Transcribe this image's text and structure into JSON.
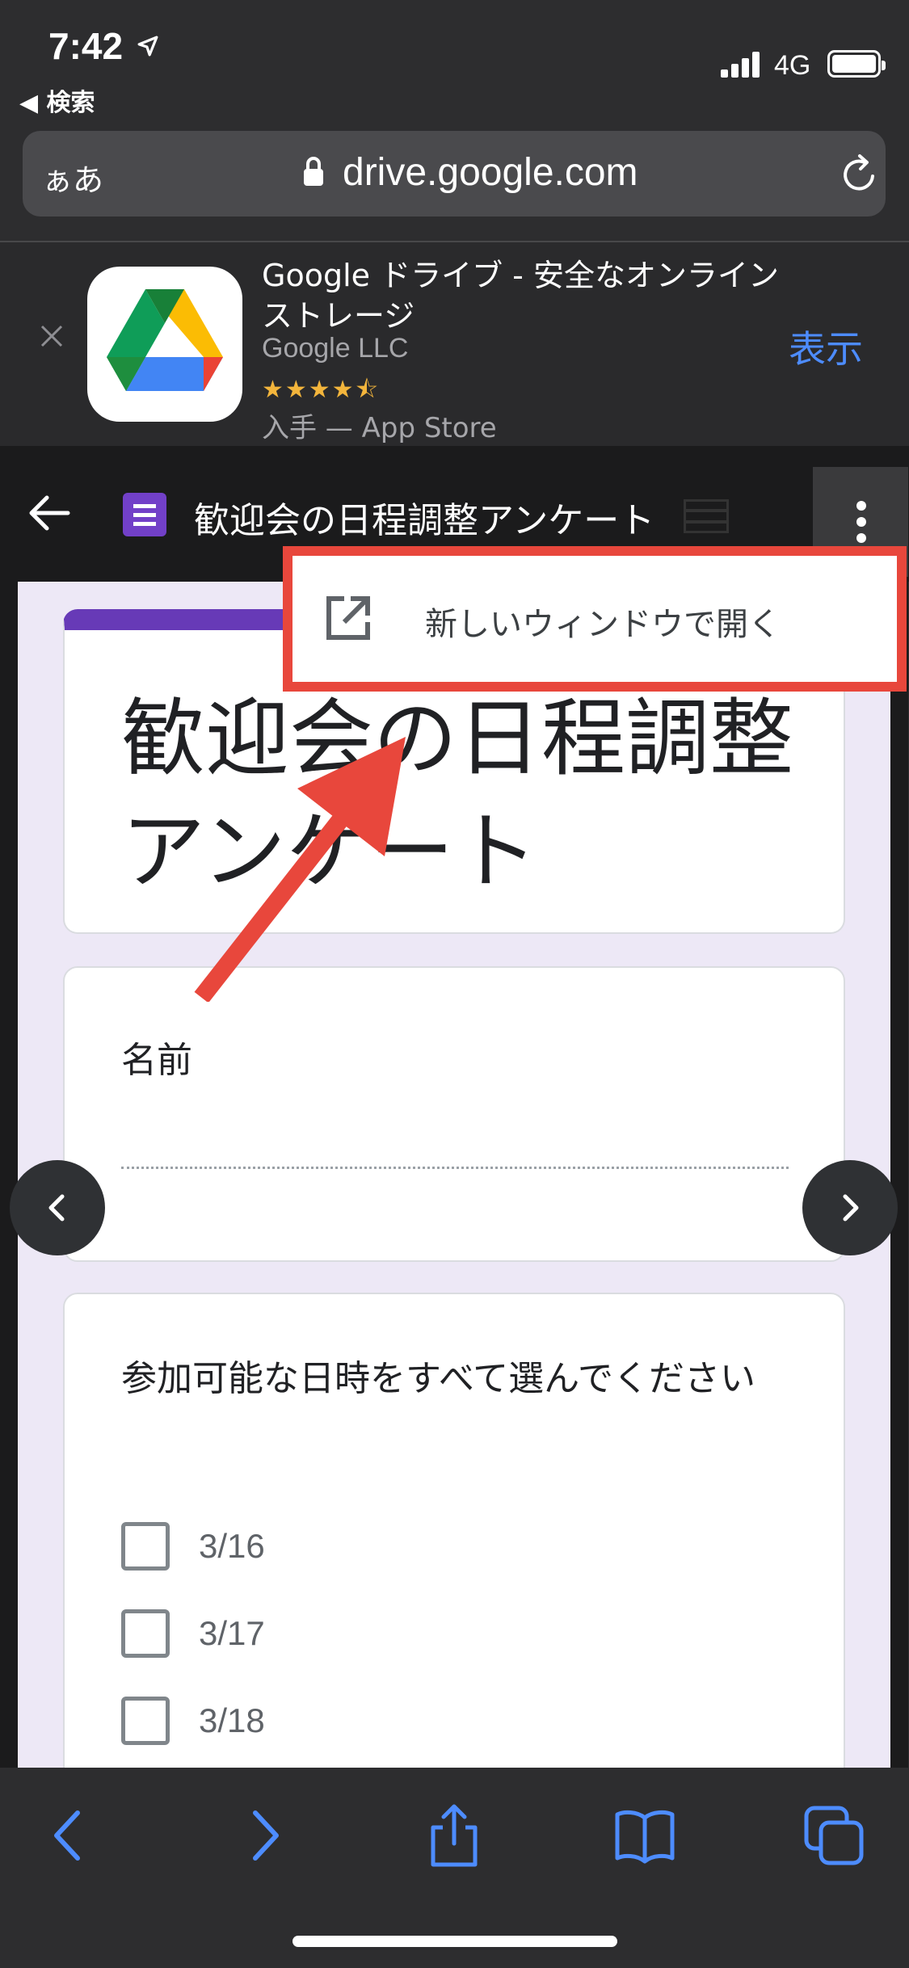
{
  "status_bar": {
    "time": "7:42",
    "back_app": "◀ 検索",
    "network": "4G"
  },
  "url_bar": {
    "text_size": "ぁあ",
    "domain": "drive.google.com"
  },
  "app_banner": {
    "app_name": "Google ドライブ - 安全なオンライン ストレージ",
    "developer": "Google LLC",
    "rating_stars": "★★★★⯪",
    "store_text": "入手 — App Store",
    "view_button": "表示"
  },
  "toolbar": {
    "title": "歓迎会の日程調整アンケート"
  },
  "menu": {
    "open_new_window": "新しいウィンドウで開く"
  },
  "form": {
    "title": "歓迎会の日程調整アンケート",
    "question_name": "名前",
    "question_dates": "参加可能な日時をすべて選んでください",
    "options": [
      "3/16",
      "3/17",
      "3/18"
    ]
  },
  "colors": {
    "accent_purple": "#673ab7",
    "highlight_red": "#e8473c",
    "ios_blue": "#4d8cff"
  }
}
